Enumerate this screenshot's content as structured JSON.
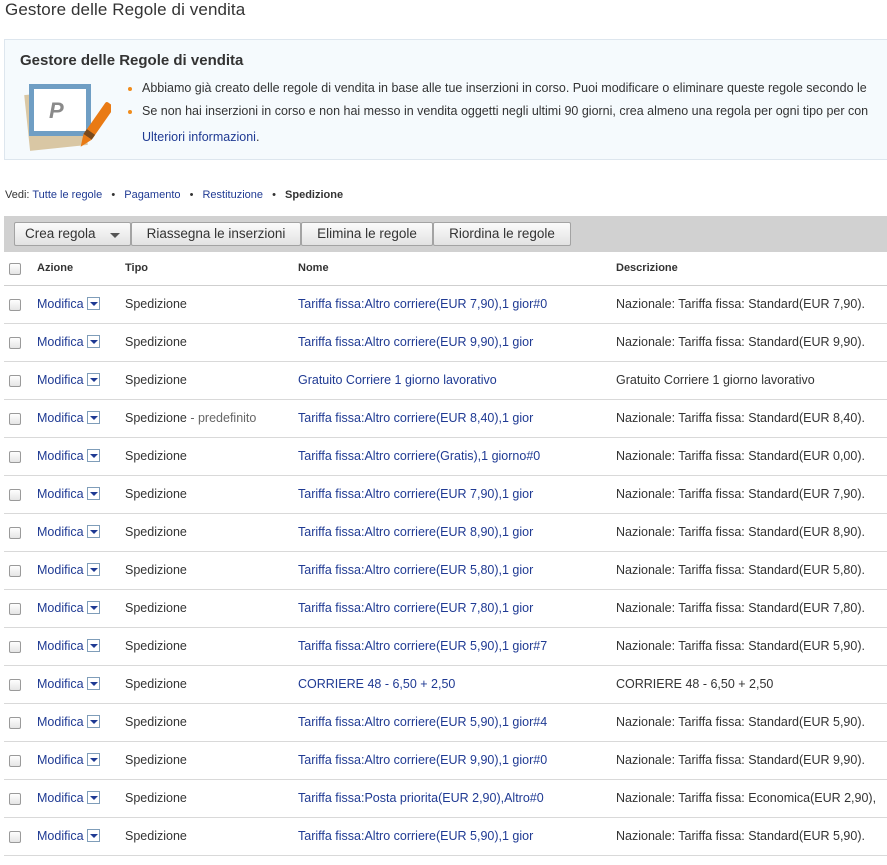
{
  "page_title": "Gestore delle Regole di vendita",
  "info": {
    "title": "Gestore delle Regole di vendita",
    "bullets": [
      "Abbiamo già creato delle regole di vendita in base alle tue inserzioni in corso. Puoi modificare o eliminare queste regole secondo le",
      "Se non hai inserzioni in corso e non hai messo in vendita oggetti negli ultimi 90 giorni, crea almeno una regola per ogni tipo per con"
    ],
    "more_link": "Ulteriori informazioni",
    "more_link_suffix": ".",
    "illustration_letter": "P"
  },
  "view": {
    "label": "Vedi:",
    "links": [
      "Tutte le regole",
      "Pagamento",
      "Restituzione"
    ],
    "current": "Spedizione",
    "separator": "•"
  },
  "toolbar": {
    "create_rule": "Crea regola",
    "reassign": "Riassegna le inserzioni",
    "delete": "Elimina le regole",
    "reorder": "Riordina le regole"
  },
  "table": {
    "headers": {
      "action": "Azione",
      "type": "Tipo",
      "name": "Nome",
      "description": "Descrizione"
    },
    "action_label": "Modifica",
    "rows": [
      {
        "type": "Spedizione",
        "default_suffix": "",
        "name": "Tariffa fissa:Altro corriere(EUR 7,90),1 gior#0",
        "description": "Nazionale: Tariffa fissa: Standard(EUR 7,90)."
      },
      {
        "type": "Spedizione",
        "default_suffix": "",
        "name": "Tariffa fissa:Altro corriere(EUR 9,90),1 gior",
        "description": "Nazionale: Tariffa fissa: Standard(EUR 9,90)."
      },
      {
        "type": "Spedizione",
        "default_suffix": "",
        "name": "Gratuito Corriere 1 giorno lavorativo",
        "description": "Gratuito Corriere 1 giorno lavorativo"
      },
      {
        "type": "Spedizione",
        "default_suffix": " - predefinito",
        "name": "Tariffa fissa:Altro corriere(EUR 8,40),1 gior",
        "description": "Nazionale: Tariffa fissa: Standard(EUR 8,40)."
      },
      {
        "type": "Spedizione",
        "default_suffix": "",
        "name": "Tariffa fissa:Altro corriere(Gratis),1 giorno#0",
        "description": "Nazionale: Tariffa fissa: Standard(EUR 0,00)."
      },
      {
        "type": "Spedizione",
        "default_suffix": "",
        "name": "Tariffa fissa:Altro corriere(EUR 7,90),1 gior",
        "description": "Nazionale: Tariffa fissa: Standard(EUR 7,90)."
      },
      {
        "type": "Spedizione",
        "default_suffix": "",
        "name": "Tariffa fissa:Altro corriere(EUR 8,90),1 gior",
        "description": "Nazionale: Tariffa fissa: Standard(EUR 8,90)."
      },
      {
        "type": "Spedizione",
        "default_suffix": "",
        "name": "Tariffa fissa:Altro corriere(EUR 5,80),1 gior",
        "description": "Nazionale: Tariffa fissa: Standard(EUR 5,80)."
      },
      {
        "type": "Spedizione",
        "default_suffix": "",
        "name": "Tariffa fissa:Altro corriere(EUR 7,80),1 gior",
        "description": "Nazionale: Tariffa fissa: Standard(EUR 7,80)."
      },
      {
        "type": "Spedizione",
        "default_suffix": "",
        "name": "Tariffa fissa:Altro corriere(EUR 5,90),1 gior#7",
        "description": "Nazionale: Tariffa fissa: Standard(EUR 5,90)."
      },
      {
        "type": "Spedizione",
        "default_suffix": "",
        "name": "CORRIERE 48 - 6,50 + 2,50",
        "description": "CORRIERE 48 - 6,50 + 2,50"
      },
      {
        "type": "Spedizione",
        "default_suffix": "",
        "name": "Tariffa fissa:Altro corriere(EUR 5,90),1 gior#4",
        "description": "Nazionale: Tariffa fissa: Standard(EUR 5,90)."
      },
      {
        "type": "Spedizione",
        "default_suffix": "",
        "name": "Tariffa fissa:Altro corriere(EUR 9,90),1 gior#0",
        "description": "Nazionale: Tariffa fissa: Standard(EUR 9,90)."
      },
      {
        "type": "Spedizione",
        "default_suffix": "",
        "name": "Tariffa fissa:Posta priorita(EUR 2,90),Altro#0",
        "description": "Nazionale: Tariffa fissa: Economica(EUR 2,90),"
      },
      {
        "type": "Spedizione",
        "default_suffix": "",
        "name": "Tariffa fissa:Altro corriere(EUR 5,90),1 gior",
        "description": "Nazionale: Tariffa fissa: Standard(EUR 5,90)."
      }
    ]
  },
  "colors": {
    "link": "#1f3a93",
    "bullet": "#f08c1c",
    "toolbar_bg": "#d1d1d1",
    "info_bg": "#f5fafd"
  }
}
